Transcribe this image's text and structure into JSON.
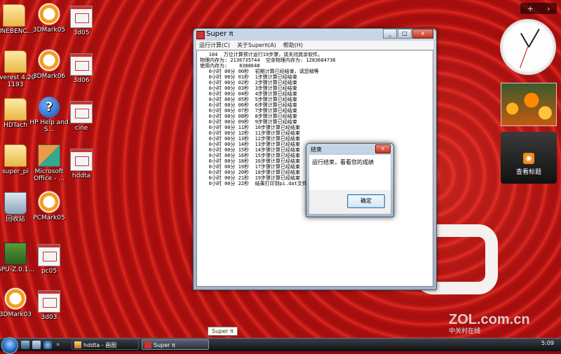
{
  "desktop_icons": [
    {
      "label": "CINEBENC..."
    },
    {
      "label": "3DMark05"
    },
    {
      "label": "3d05"
    },
    {
      "label": "Everest 4.20 1193"
    },
    {
      "label": "3DMark06"
    },
    {
      "label": "3d06"
    },
    {
      "label": "HDTach"
    },
    {
      "label": "HP Help and S..."
    },
    {
      "label": "cine"
    },
    {
      "label": "super_pi"
    },
    {
      "label": "Microsoft Office - ..."
    },
    {
      "label": "hddta"
    },
    {
      "label": "回收站"
    },
    {
      "label": "PCMark05"
    },
    {
      "label": "GPU-Z.0.1..."
    },
    {
      "label": "pc05"
    },
    {
      "label": "3DMark03"
    },
    {
      "label": "3d03"
    }
  ],
  "gadgets": {
    "bar_plus": "+",
    "bar_arrow": "›",
    "feed_label": "查看标题"
  },
  "window": {
    "title": "Super π",
    "menu": [
      "运行计算(C)",
      "关于Superπ(A)",
      "帮助(H)"
    ],
    "log_lines": [
      "   104  万位计算预计运行19步骤，请关闭其余软件。",
      "物理内存为: 2136735744  空余物理内存为: 1283684736",
      "使用内存为:    8388648",
      "   0小时 00分 00秒  初期计算已经结束，请您稍等",
      "   0小时 00分 01秒  1步骤计算已经结束",
      "   0小时 00分 02秒  2步骤计算已经结束",
      "   0小时 00分 03秒  3步骤计算已经结束",
      "   0小时 00分 04秒  4步骤计算已经结束",
      "   0小时 00分 05秒  5步骤计算已经结束",
      "   0小时 00分 06秒  6步骤计算已经结束",
      "   0小时 00分 07秒  7步骤计算已经结束",
      "   0小时 00分 08秒  8步骤计算已经结束",
      "   0小时 00分 09秒  9步骤计算已经结束",
      "   0小时 00分 11秒  10步骤计算已经结束",
      "   0小时 00分 12秒  11步骤计算已经结束",
      "   0小时 00分 13秒  12步骤计算已经结束",
      "   0小时 00分 14秒  13步骤计算已经结束",
      "   0小时 00分 15秒  14步骤计算已经结束",
      "   0小时 00分 16秒  15步骤计算已经结束",
      "   0小时 00分 18秒  16步骤计算已经结束",
      "   0小时 00分 19秒  17步骤计算已经结束",
      "   0小时 00分 20秒  18步骤计算已经结束",
      "   0小时 00分 21秒  19步骤计算已经结束",
      "   0小时 00分 22秒  结果打印到pi.dat文件，请等待"
    ]
  },
  "dialog": {
    "title": "结束",
    "message": "运行结束，看看您的成绩",
    "ok_label": "确定",
    "close_glyph": "x"
  },
  "tooltip": "Super π",
  "taskbar": {
    "tasks": [
      "hddta - 画图",
      "Super π"
    ],
    "clock": "5:09"
  },
  "watermark": {
    "main": "ZOL.com.cn",
    "sub": "中关村在线"
  },
  "colors": {
    "desktop_red": "#a50e0e",
    "accent_orange": "#f59c1a"
  }
}
